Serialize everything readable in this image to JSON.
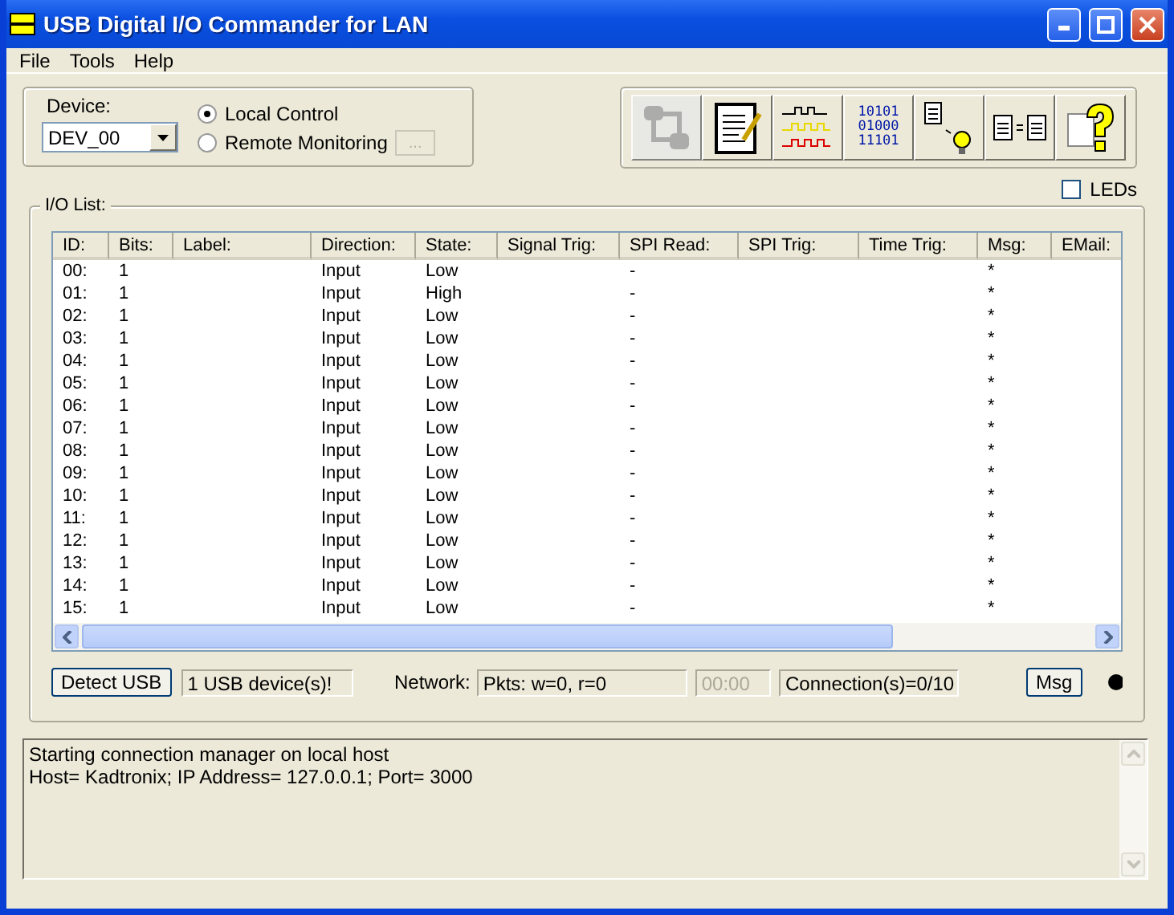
{
  "window": {
    "title": "USB Digital I/O Commander for LAN"
  },
  "menu": [
    "File",
    "Tools",
    "Help"
  ],
  "device": {
    "label": "Device:",
    "value": "DEV_00"
  },
  "modes": [
    {
      "label": "Local Control",
      "selected": true
    },
    {
      "label": "Remote Monitoring",
      "selected": false
    }
  ],
  "remote_button": {
    "label": "...",
    "disabled": true
  },
  "toolbar": [
    {
      "kind": "network",
      "disabled": true
    },
    {
      "kind": "notepad",
      "disabled": false
    },
    {
      "kind": "waves",
      "disabled": false
    },
    {
      "kind": "binary",
      "disabled": false,
      "lines": [
        "10101",
        "01000",
        "11101"
      ]
    },
    {
      "kind": "bulb",
      "disabled": false
    },
    {
      "kind": "compare",
      "disabled": false
    },
    {
      "kind": "help",
      "disabled": false
    }
  ],
  "leds": {
    "label": "LEDs",
    "checked": false
  },
  "io_list": {
    "title": "I/O List:",
    "columns": [
      "ID:",
      "Bits:",
      "Label:",
      "Direction:",
      "State:",
      "Signal Trig:",
      "SPI Read:",
      "SPI Trig:",
      "Time Trig:",
      "Msg:",
      "EMail:"
    ],
    "rows": [
      [
        "00:",
        "1",
        "",
        "Input",
        "Low",
        "",
        "-",
        "",
        "",
        "*",
        ""
      ],
      [
        "01:",
        "1",
        "",
        "Input",
        "High",
        "",
        "-",
        "",
        "",
        "*",
        ""
      ],
      [
        "02:",
        "1",
        "",
        "Input",
        "Low",
        "",
        "-",
        "",
        "",
        "*",
        ""
      ],
      [
        "03:",
        "1",
        "",
        "Input",
        "Low",
        "",
        "-",
        "",
        "",
        "*",
        ""
      ],
      [
        "04:",
        "1",
        "",
        "Input",
        "Low",
        "",
        "-",
        "",
        "",
        "*",
        ""
      ],
      [
        "05:",
        "1",
        "",
        "Input",
        "Low",
        "",
        "-",
        "",
        "",
        "*",
        ""
      ],
      [
        "06:",
        "1",
        "",
        "Input",
        "Low",
        "",
        "-",
        "",
        "",
        "*",
        ""
      ],
      [
        "07:",
        "1",
        "",
        "Input",
        "Low",
        "",
        "-",
        "",
        "",
        "*",
        ""
      ],
      [
        "08:",
        "1",
        "",
        "Input",
        "Low",
        "",
        "-",
        "",
        "",
        "*",
        ""
      ],
      [
        "09:",
        "1",
        "",
        "Input",
        "Low",
        "",
        "-",
        "",
        "",
        "*",
        ""
      ],
      [
        "10:",
        "1",
        "",
        "Input",
        "Low",
        "",
        "-",
        "",
        "",
        "*",
        ""
      ],
      [
        "11:",
        "1",
        "",
        "Input",
        "Low",
        "",
        "-",
        "",
        "",
        "*",
        ""
      ],
      [
        "12:",
        "1",
        "",
        "Input",
        "Low",
        "",
        "-",
        "",
        "",
        "*",
        ""
      ],
      [
        "13:",
        "1",
        "",
        "Input",
        "Low",
        "",
        "-",
        "",
        "",
        "*",
        ""
      ],
      [
        "14:",
        "1",
        "",
        "Input",
        "Low",
        "",
        "-",
        "",
        "",
        "*",
        ""
      ],
      [
        "15:",
        "1",
        "",
        "Input",
        "Low",
        "",
        "-",
        "",
        "",
        "*",
        ""
      ]
    ]
  },
  "status": {
    "detect_button": "Detect USB",
    "devices": "1 USB device(s)!",
    "network_label": "Network:",
    "packets": "Pkts: w=0, r=0",
    "timer": {
      "text": "00:00",
      "disabled": true
    },
    "connections": "Connection(s)=0/10",
    "msg_button": "Msg"
  },
  "log": [
    "Starting connection manager on local host",
    "Host= Kadtronix;  IP Address= 127.0.0.1;  Port= 3000"
  ]
}
